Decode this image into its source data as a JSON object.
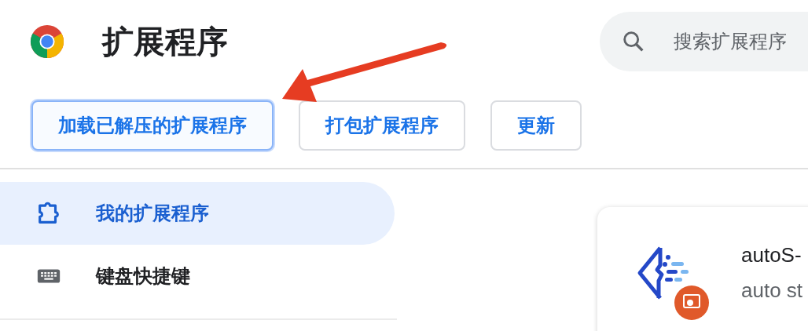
{
  "header": {
    "title": "扩展程序",
    "search": {
      "placeholder": "搜索扩展程序"
    }
  },
  "toolbar": {
    "buttons": [
      {
        "label": "加载已解压的扩展程序",
        "focused": true
      },
      {
        "label": "打包扩展程序",
        "focused": false
      },
      {
        "label": "更新",
        "focused": false
      }
    ]
  },
  "sidebar": {
    "items": [
      {
        "label": "我的扩展程序",
        "selected": true
      },
      {
        "label": "键盘快捷键",
        "selected": false
      }
    ]
  },
  "extension_card": {
    "name": "autoS-",
    "description": "auto st"
  }
}
